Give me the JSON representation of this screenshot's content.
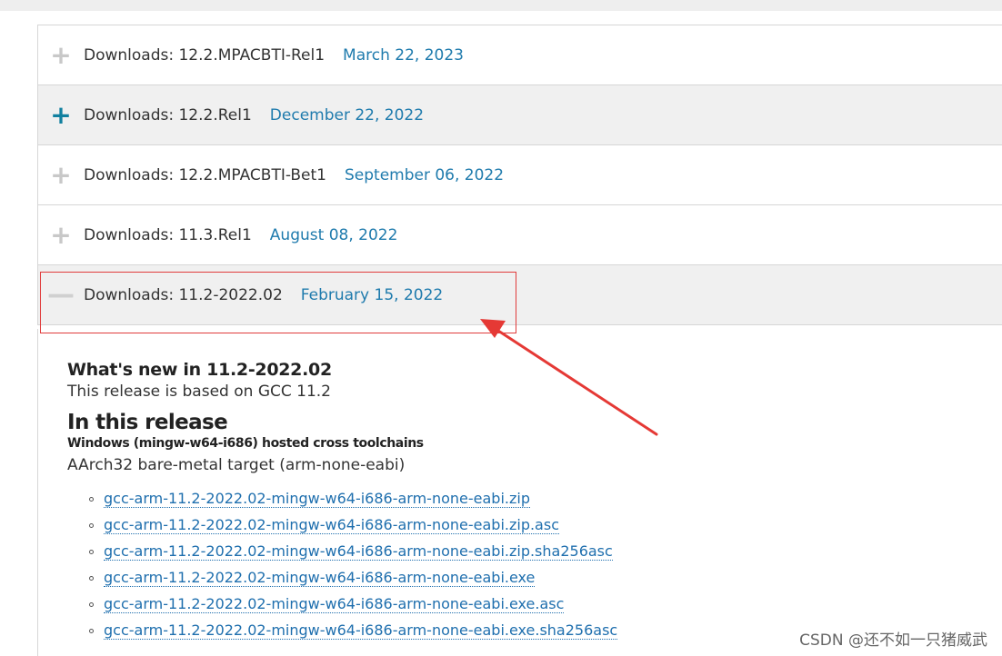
{
  "accordion": {
    "rows": [
      {
        "icon": "+",
        "label": "Downloads: 12.2.MPACBTI-Rel1",
        "date": "March 22, 2023"
      },
      {
        "icon": "+",
        "label": "Downloads: 12.2.Rel1",
        "date": "December 22, 2022"
      },
      {
        "icon": "+",
        "label": "Downloads: 12.2.MPACBTI-Bet1",
        "date": "September 06, 2022"
      },
      {
        "icon": "+",
        "label": "Downloads: 11.3.Rel1",
        "date": "August 08, 2022"
      },
      {
        "icon": "—",
        "label": "Downloads: 11.2-2022.02",
        "date": "February 15, 2022"
      }
    ]
  },
  "panel": {
    "whats_new": "What's new in 11.2-2022.02",
    "based_on": "This release is based on GCC 11.2",
    "in_release": "In this release",
    "hosted": "Windows (mingw-w64-i686) hosted cross toolchains",
    "target": "AArch32 bare-metal target (arm-none-eabi)",
    "files": [
      "gcc-arm-11.2-2022.02-mingw-w64-i686-arm-none-eabi.zip",
      "gcc-arm-11.2-2022.02-mingw-w64-i686-arm-none-eabi.zip.asc",
      "gcc-arm-11.2-2022.02-mingw-w64-i686-arm-none-eabi.zip.sha256asc",
      "gcc-arm-11.2-2022.02-mingw-w64-i686-arm-none-eabi.exe",
      "gcc-arm-11.2-2022.02-mingw-w64-i686-arm-none-eabi.exe.asc",
      "gcc-arm-11.2-2022.02-mingw-w64-i686-arm-none-eabi.exe.sha256asc"
    ]
  },
  "watermark": "CSDN @还不如一只猪威武",
  "colors": {
    "accent": "#11809f",
    "date": "#1f7bad",
    "link": "#1f6fae",
    "annotation": "#e03c3c"
  }
}
